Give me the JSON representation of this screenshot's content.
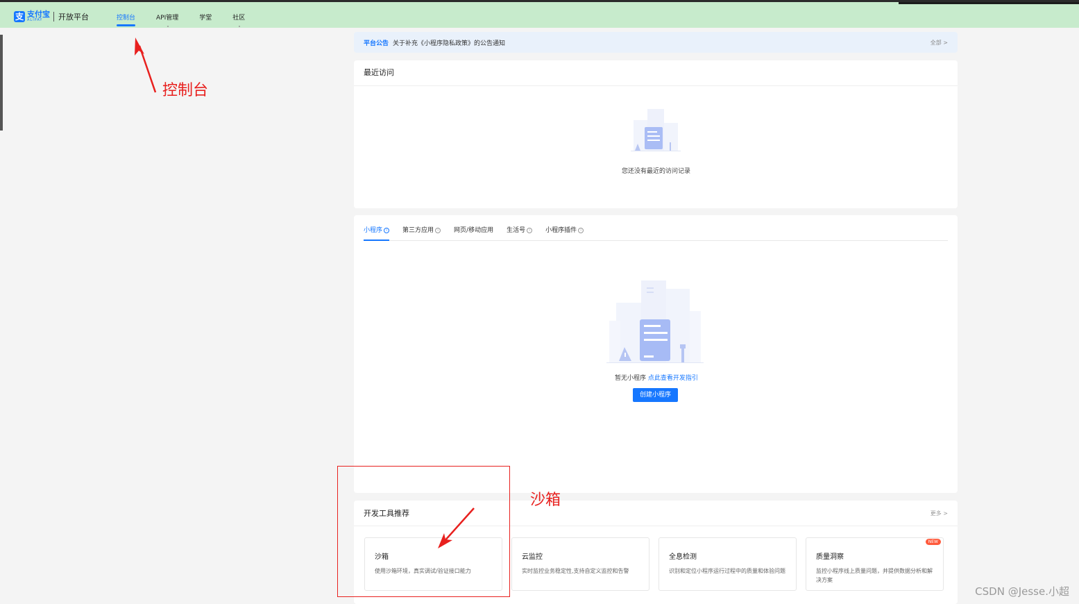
{
  "logo": {
    "cn": "支付宝",
    "en": "ALIPAY",
    "mark": "支",
    "platform": "开放平台"
  },
  "nav": {
    "items": [
      {
        "label": "控制台"
      },
      {
        "label": "API管理"
      },
      {
        "label": "学堂"
      },
      {
        "label": "社区"
      }
    ]
  },
  "notice": {
    "tag": "平台公告",
    "text": "关于补充《小程序隐私政策》的公告通知",
    "all": "全部 >"
  },
  "recent": {
    "title": "最近访问",
    "empty_text": "您还没有最近的访问记录"
  },
  "apps": {
    "tabs": [
      {
        "label": "小程序"
      },
      {
        "label": "第三方应用"
      },
      {
        "label": "网页/移动应用"
      },
      {
        "label": "生活号"
      },
      {
        "label": "小程序插件"
      }
    ],
    "empty_prefix": "暂无小程序",
    "empty_link": "点此查看开发指引",
    "create_button": "创建小程序"
  },
  "tools": {
    "title": "开发工具推荐",
    "more": "更多 >",
    "cards": [
      {
        "name": "沙箱",
        "desc": "使用沙箱环境，真实调试/验证接口能力"
      },
      {
        "name": "云监控",
        "desc": "实时监控业务稳定性,支持自定义监控和告警"
      },
      {
        "name": "全息检测",
        "desc": "识别和定位小程序运行过程中的质量和体验问题"
      },
      {
        "name": "质量洞察",
        "desc": "监控小程序线上质量问题，并提供数据分析和解决方案",
        "badge": "NEW"
      }
    ]
  },
  "annotations": {
    "console": "控制台",
    "sandbox": "沙箱"
  },
  "watermark": "CSDN @Jesse.小超",
  "colors": {
    "accent": "#1677ff",
    "topbar": "#c7ebcc",
    "annotation": "#e8201e"
  }
}
